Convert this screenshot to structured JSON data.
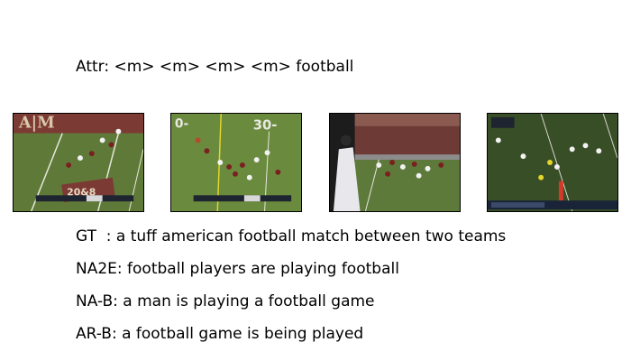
{
  "attr_line": "Attr: <m> <m> <m> <m> football",
  "frames": [
    {
      "name": "frame-1",
      "scene": "field with maroon end zone lettering"
    },
    {
      "name": "frame-2",
      "scene": "players near yard line with 30 marker"
    },
    {
      "name": "frame-3",
      "scene": "sideline view with crowd in stands"
    },
    {
      "name": "frame-4",
      "scene": "dark field with players and score overlay"
    }
  ],
  "captions": {
    "gt": "GT  : a tuff american football match between two teams",
    "na2e": "NA2E: football players are playing football",
    "na_b": "NA-B: a man is playing a football game",
    "ar_b": "AR-B: a football game is being played"
  }
}
